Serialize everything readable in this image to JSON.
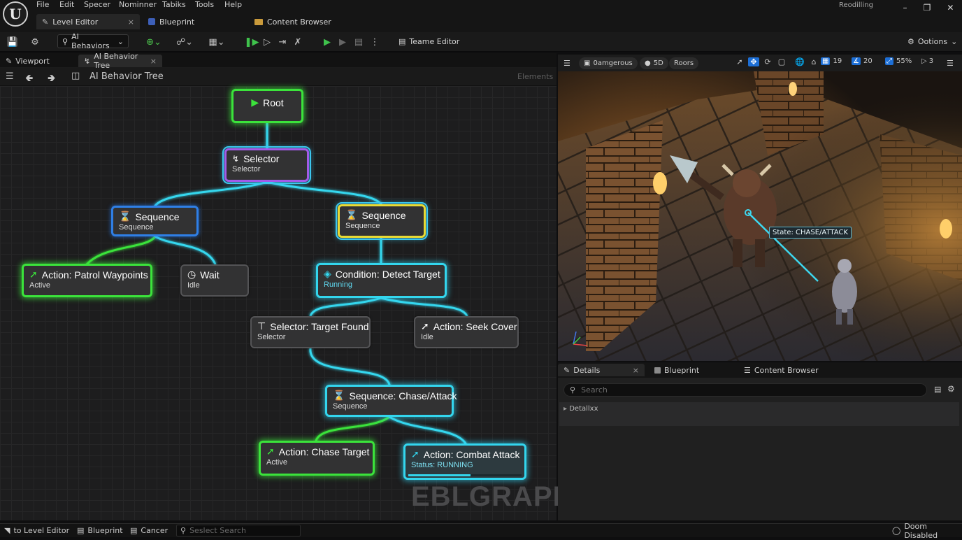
{
  "menubar": {
    "items": [
      "File",
      "Edit",
      "Specer",
      "Nominner",
      "Tabiks",
      "Tools",
      "Help"
    ],
    "right_label": "Reodilling"
  },
  "doc_tabs": {
    "level_editor": "Level Editor",
    "blueprint": "Blueprint",
    "content_browser": "Content Browser"
  },
  "toolbar": {
    "ai_behaviors": "AI Behaviors",
    "teame_editor": "Teame Editor",
    "options": "Ootions"
  },
  "panel_tabs": {
    "viewport": "Viewport",
    "ai_behavior_tree": "AI Behavior Tree"
  },
  "graph_header": {
    "title": "AI Behavior Tree",
    "elements": "Elements"
  },
  "nodes": {
    "root": {
      "title": "Root"
    },
    "selector": {
      "title": "Selector",
      "sub": "Selector"
    },
    "sequence_left": {
      "title": "Sequence",
      "sub": "Sequence"
    },
    "sequence_right": {
      "title": "Sequence",
      "sub": "Sequence"
    },
    "patrol": {
      "title": "Action: Patrol Waypoints",
      "sub": "Active"
    },
    "wait": {
      "title": "Wait",
      "sub": "Idle"
    },
    "detect": {
      "title": "Condition: Detect Target",
      "sub": "Running"
    },
    "target_found": {
      "title": "Selector: Target Found",
      "sub": "Selector"
    },
    "seek_cover": {
      "title": "Action: Seek Cover",
      "sub": "Idle"
    },
    "chase_attack": {
      "title": "Sequence: Chase/Attack",
      "sub": "Sequence"
    },
    "chase_target": {
      "title": "Action: Chase Target",
      "sub": "Active"
    },
    "combat_attack": {
      "title": "Action: Combat Attack",
      "sub": "Status: RUNNING",
      "progress": 0.55
    }
  },
  "watermark": "EBLGRAPH",
  "viewport": {
    "chip_dangerous": "0amgerous",
    "chip_3d": "5D",
    "chip_roors": "Roors",
    "num_19": "19",
    "num_20": "20",
    "zoom": "55%",
    "cam": "3",
    "state_label": "State: CHASE/ATTACK"
  },
  "details": {
    "tab_details": "Details",
    "tab_blueprint": "Blueprint",
    "tab_content": "Content Browser",
    "search_placeholder": "Search",
    "row_label": "Detallxx"
  },
  "status": {
    "level_editor": "to Level Editor",
    "blueprint": "Blueprint",
    "cancel": "Cancer",
    "search_placeholder": "Seslect Search",
    "right": "Doom Disabled"
  },
  "colors": {
    "green": "#3be33b",
    "cyan": "#33d6ee",
    "purple": "#a25be8",
    "blue": "#2f7fe6",
    "yellow": "#e8da35",
    "accent_blue": "#1d6fd6"
  }
}
